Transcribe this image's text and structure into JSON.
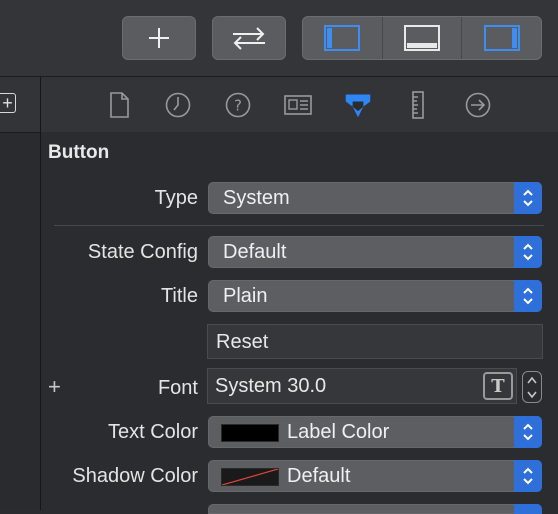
{
  "toolbar": {
    "buttons": [
      {
        "name": "add-button",
        "icon": "plus-icon"
      },
      {
        "name": "swap-button",
        "icon": "swap-arrows-icon"
      }
    ],
    "panel_toggles": [
      {
        "name": "toggle-navigator",
        "icon": "left-panel-icon",
        "color": "#3d8ef0"
      },
      {
        "name": "toggle-debug-area",
        "icon": "bottom-panel-icon",
        "color": "#e8e8e8"
      },
      {
        "name": "toggle-inspector",
        "icon": "right-panel-icon",
        "color": "#3d8ef0"
      }
    ]
  },
  "inspector_tabs": [
    {
      "name": "file-inspector",
      "icon": "file-icon"
    },
    {
      "name": "history-inspector",
      "icon": "clock-icon"
    },
    {
      "name": "help-inspector",
      "icon": "question-icon"
    },
    {
      "name": "identity-inspector",
      "icon": "id-card-icon"
    },
    {
      "name": "attributes-inspector",
      "icon": "attributes-icon",
      "selected": true
    },
    {
      "name": "size-inspector",
      "icon": "ruler-icon"
    },
    {
      "name": "connections-inspector",
      "icon": "arrow-circle-icon"
    }
  ],
  "section": {
    "title": "Button"
  },
  "fields": {
    "type": {
      "label": "Type",
      "value": "System"
    },
    "state_config": {
      "label": "State Config",
      "value": "Default"
    },
    "title": {
      "label": "Title",
      "value": "Plain"
    },
    "title_text": {
      "value": "Reset"
    },
    "font": {
      "label": "Font",
      "value": "System 30.0",
      "add_symbol": "+",
      "t_glyph": "T"
    },
    "text_color": {
      "label": "Text Color",
      "value": "Label Color",
      "swatch": "#000000"
    },
    "shadow_color": {
      "label": "Shadow Color",
      "value": "Default"
    }
  },
  "colors": {
    "accent": "#2f6fd9",
    "background": "#2b2c2f"
  }
}
